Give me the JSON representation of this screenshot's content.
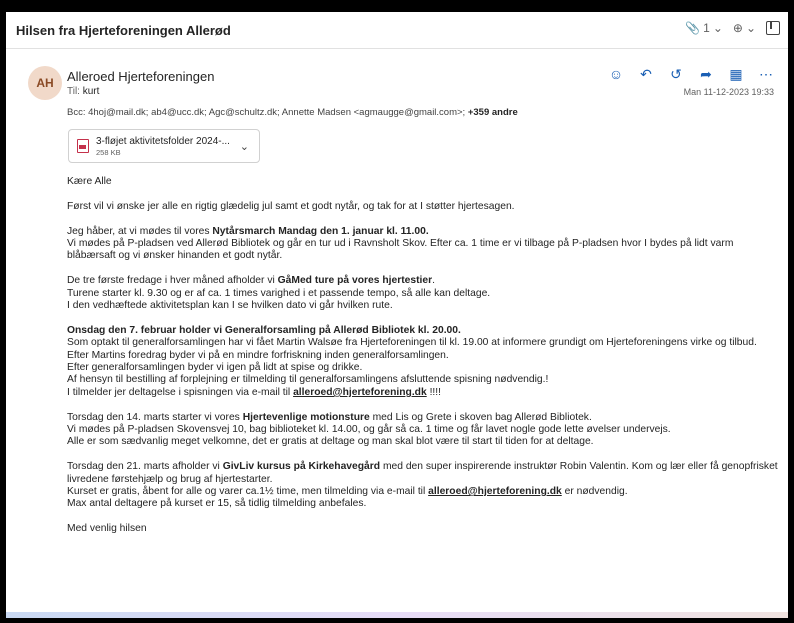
{
  "header": {
    "title": "Hilsen fra Hjerteforeningen Allerød",
    "attach_count": "1",
    "zoom_icon": "zoom-icon",
    "popout_icon": "popout-icon"
  },
  "message": {
    "avatar": "AH",
    "sender": "Alleroed Hjerteforeningen",
    "to_label": "Til:",
    "to_value": "kurt",
    "date": "Man 11-12-2023 19:33",
    "bcc_text": "Bcc: 4hoj@mail.dk; ab4@ucc.dk; Agc@schultz.dk; Annette Madsen <agmaugge@gmail.com>; ",
    "bcc_more": "+359 andre"
  },
  "attachment": {
    "name": "3-fløjet aktivitetsfolder 2024-...",
    "size": "258 KB"
  },
  "body": {
    "greeting": "Kære Alle",
    "p1": "Først vil vi ønske jer alle en rigtig glædelig jul samt et godt nytår, og tak for at I støtter hjertesagen.",
    "p2_a": "Jeg håber, at vi mødes til vores ",
    "p2_b": "Nytårsmarch Mandag den 1. januar kl. 11.00.",
    "p2_c": "Vi mødes på P-pladsen ved Allerød Bibliotek og går en tur ud i Ravnsholt Skov. Efter ca. 1 time er vi tilbage på P-pladsen hvor I bydes på lidt varm blåbærsaft og vi ønsker hinanden et godt nytår.",
    "p3_a": "De tre første fredage i hver måned afholder vi ",
    "p3_b": "GåMed ture på vores hjertestier",
    "p3_c": ".",
    "p3_d": "Turene starter kl. 9.30 og er af ca. 1 times varighed i et passende tempo, så alle kan deltage.",
    "p3_e": "I den vedhæftede aktivitetsplan kan I se hvilken dato vi går hvilken rute.",
    "p4_a": "Onsdag den 7. februar holder vi Generalforsamling  på Allerød Bibliotek kl. 20.00.",
    "p4_b": "Som optakt til generalforsamlingen har vi fået Martin Walsøe fra Hjerteforeningen til kl. 19.00 at informere grundigt om Hjerteforeningens virke og tilbud.",
    "p4_c": "Efter Martins foredrag byder vi på en mindre forfriskning inden generalforsamlingen.",
    "p4_d": "Efter generalforsamlingen byder vi igen på lidt at spise og drikke.",
    "p4_e": "Af hensyn til bestilling af forplejning er tilmelding til generalforsamlingens afsluttende spisning nødvendig.!",
    "p4_f": "I tilmelder jer deltagelse i spisningen via e-mail til ",
    "email": "alleroed@hjerteforening.dk",
    "p4_g": " !!!!",
    "p5_a": "Torsdag den 14. marts starter vi vores ",
    "p5_b": "Hjertevenlige motionsture",
    "p5_c": " med Lis og Grete i skoven bag Allerød Bibliotek.",
    "p5_d": "Vi mødes på P-pladsen Skovensvej 10, bag biblioteket kl. 14.00, og går så ca. 1 time og får lavet nogle gode lette øvelser undervejs.",
    "p5_e": "Alle er som sædvanlig meget velkomne, det er gratis at deltage og man skal blot være til start til tiden for at deltage.",
    "p6_a": "Torsdag den 21. marts afholder vi ",
    "p6_b": "GivLiv kursus på Kirkehavegård",
    "p6_c": " med den super inspirerende instruktør Robin Valentin. Kom og lær eller få genopfrisket livredene førstehjælp og brug af hjertestarter.",
    "p6_d": "Kurset er gratis, åbent for alle og varer ca.1½ time, men tilmelding via e-mail til ",
    "p6_e": " er nødvendig.",
    "p6_f": "Max antal deltagere på kurset er 15, så tidlig tilmelding anbefales.",
    "closing": "Med venlig hilsen"
  },
  "colors": {
    "accent": "#1a5fb4",
    "avatar_bg": "#f1d9c9",
    "attachment_icon": "#c4314b"
  }
}
